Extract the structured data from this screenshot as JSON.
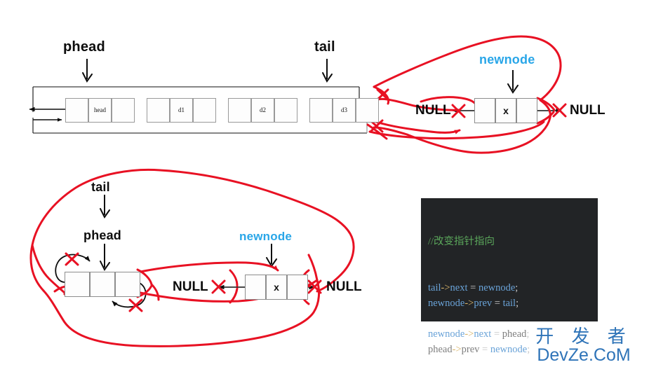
{
  "title": "Doubly linked list insertion diagram",
  "top_diagram": {
    "labels": {
      "phead": "phead",
      "tail": "tail",
      "newnode": "newnode"
    },
    "nodes": [
      {
        "data": "head"
      },
      {
        "data": "d1"
      },
      {
        "data": "d2"
      },
      {
        "data": "d3"
      }
    ],
    "newnode": {
      "data": "x"
    },
    "null_left": "NULL",
    "null_right": "NULL"
  },
  "bottom_diagram": {
    "labels": {
      "tail": "tail",
      "phead": "phead",
      "newnode": "newnode"
    },
    "node": {
      "data": ""
    },
    "newnode": {
      "data": "x"
    },
    "null_left": "NULL",
    "null_right": "NULL"
  },
  "code": {
    "comment": "//改变指针指向",
    "lines": [
      {
        "lhs": "tail",
        "arrow": "->",
        "field": "next",
        "op": "=",
        "rhs": "newnode",
        "semi": ";",
        "lhs_style": "blue",
        "rhs_style": "blue"
      },
      {
        "lhs": "newnode",
        "arrow": "->",
        "field": "prev",
        "op": "=",
        "rhs": "tail",
        "semi": ";",
        "lhs_style": "blue",
        "rhs_style": "blue"
      },
      {
        "lhs": "",
        "arrow": "",
        "field": "",
        "op": "",
        "rhs": "",
        "semi": "",
        "lhs_style": "blank",
        "rhs_style": "blank"
      },
      {
        "lhs": "newnode",
        "arrow": "->",
        "field": "next",
        "op": "=",
        "rhs": "phead",
        "semi": ";",
        "lhs_style": "blue",
        "rhs_style": "grey"
      },
      {
        "lhs": "phead",
        "arrow": "->",
        "field": "prev",
        "op": "=",
        "rhs": "newnode",
        "semi": ";",
        "lhs_style": "grey",
        "rhs_style": "blue"
      }
    ]
  },
  "watermark": {
    "line1": "开 发 者",
    "line2": "DevZe.CoM"
  },
  "colors": {
    "accent_blue": "#29a6e8",
    "annotation_red": "#e81123",
    "code_bg": "#222426",
    "code_comment": "#5aa55a",
    "code_identifier": "#6aa3d8",
    "code_dim": "#7f7f7f",
    "code_arrow": "#d8b46a",
    "watermark_blue": "#2f74b8",
    "node_border": "#9a9a9a"
  }
}
